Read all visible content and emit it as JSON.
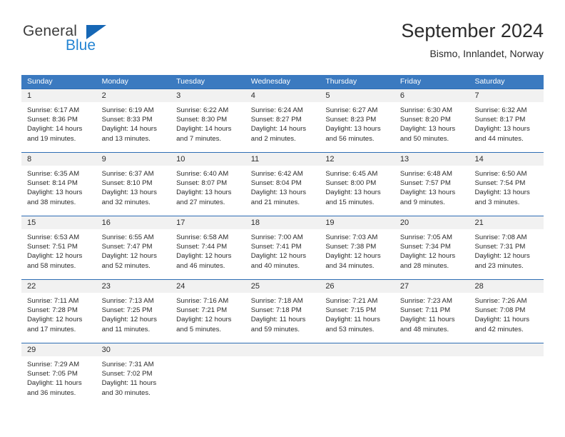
{
  "brand": {
    "name_top": "General",
    "name_bottom": "Blue",
    "triangle_color": "#1667b5",
    "blue_text_color": "#2585d3",
    "general_text_color": "#3c3c3c"
  },
  "header": {
    "title": "September 2024",
    "subtitle": "Bismo, Innlandet, Norway"
  },
  "theme": {
    "header_row_bg": "#3b7ac0",
    "week_divider": "#2e6db4",
    "day_band_bg": "#f1f1f1",
    "text": "#2b2b2b"
  },
  "weekdays": [
    "Sunday",
    "Monday",
    "Tuesday",
    "Wednesday",
    "Thursday",
    "Friday",
    "Saturday"
  ],
  "weeks": [
    [
      {
        "day": "1",
        "sunrise": "Sunrise: 6:17 AM",
        "sunset": "Sunset: 8:36 PM",
        "daylight_1": "Daylight: 14 hours",
        "daylight_2": "and 19 minutes."
      },
      {
        "day": "2",
        "sunrise": "Sunrise: 6:19 AM",
        "sunset": "Sunset: 8:33 PM",
        "daylight_1": "Daylight: 14 hours",
        "daylight_2": "and 13 minutes."
      },
      {
        "day": "3",
        "sunrise": "Sunrise: 6:22 AM",
        "sunset": "Sunset: 8:30 PM",
        "daylight_1": "Daylight: 14 hours",
        "daylight_2": "and 7 minutes."
      },
      {
        "day": "4",
        "sunrise": "Sunrise: 6:24 AM",
        "sunset": "Sunset: 8:27 PM",
        "daylight_1": "Daylight: 14 hours",
        "daylight_2": "and 2 minutes."
      },
      {
        "day": "5",
        "sunrise": "Sunrise: 6:27 AM",
        "sunset": "Sunset: 8:23 PM",
        "daylight_1": "Daylight: 13 hours",
        "daylight_2": "and 56 minutes."
      },
      {
        "day": "6",
        "sunrise": "Sunrise: 6:30 AM",
        "sunset": "Sunset: 8:20 PM",
        "daylight_1": "Daylight: 13 hours",
        "daylight_2": "and 50 minutes."
      },
      {
        "day": "7",
        "sunrise": "Sunrise: 6:32 AM",
        "sunset": "Sunset: 8:17 PM",
        "daylight_1": "Daylight: 13 hours",
        "daylight_2": "and 44 minutes."
      }
    ],
    [
      {
        "day": "8",
        "sunrise": "Sunrise: 6:35 AM",
        "sunset": "Sunset: 8:14 PM",
        "daylight_1": "Daylight: 13 hours",
        "daylight_2": "and 38 minutes."
      },
      {
        "day": "9",
        "sunrise": "Sunrise: 6:37 AM",
        "sunset": "Sunset: 8:10 PM",
        "daylight_1": "Daylight: 13 hours",
        "daylight_2": "and 32 minutes."
      },
      {
        "day": "10",
        "sunrise": "Sunrise: 6:40 AM",
        "sunset": "Sunset: 8:07 PM",
        "daylight_1": "Daylight: 13 hours",
        "daylight_2": "and 27 minutes."
      },
      {
        "day": "11",
        "sunrise": "Sunrise: 6:42 AM",
        "sunset": "Sunset: 8:04 PM",
        "daylight_1": "Daylight: 13 hours",
        "daylight_2": "and 21 minutes."
      },
      {
        "day": "12",
        "sunrise": "Sunrise: 6:45 AM",
        "sunset": "Sunset: 8:00 PM",
        "daylight_1": "Daylight: 13 hours",
        "daylight_2": "and 15 minutes."
      },
      {
        "day": "13",
        "sunrise": "Sunrise: 6:48 AM",
        "sunset": "Sunset: 7:57 PM",
        "daylight_1": "Daylight: 13 hours",
        "daylight_2": "and 9 minutes."
      },
      {
        "day": "14",
        "sunrise": "Sunrise: 6:50 AM",
        "sunset": "Sunset: 7:54 PM",
        "daylight_1": "Daylight: 13 hours",
        "daylight_2": "and 3 minutes."
      }
    ],
    [
      {
        "day": "15",
        "sunrise": "Sunrise: 6:53 AM",
        "sunset": "Sunset: 7:51 PM",
        "daylight_1": "Daylight: 12 hours",
        "daylight_2": "and 58 minutes."
      },
      {
        "day": "16",
        "sunrise": "Sunrise: 6:55 AM",
        "sunset": "Sunset: 7:47 PM",
        "daylight_1": "Daylight: 12 hours",
        "daylight_2": "and 52 minutes."
      },
      {
        "day": "17",
        "sunrise": "Sunrise: 6:58 AM",
        "sunset": "Sunset: 7:44 PM",
        "daylight_1": "Daylight: 12 hours",
        "daylight_2": "and 46 minutes."
      },
      {
        "day": "18",
        "sunrise": "Sunrise: 7:00 AM",
        "sunset": "Sunset: 7:41 PM",
        "daylight_1": "Daylight: 12 hours",
        "daylight_2": "and 40 minutes."
      },
      {
        "day": "19",
        "sunrise": "Sunrise: 7:03 AM",
        "sunset": "Sunset: 7:38 PM",
        "daylight_1": "Daylight: 12 hours",
        "daylight_2": "and 34 minutes."
      },
      {
        "day": "20",
        "sunrise": "Sunrise: 7:05 AM",
        "sunset": "Sunset: 7:34 PM",
        "daylight_1": "Daylight: 12 hours",
        "daylight_2": "and 28 minutes."
      },
      {
        "day": "21",
        "sunrise": "Sunrise: 7:08 AM",
        "sunset": "Sunset: 7:31 PM",
        "daylight_1": "Daylight: 12 hours",
        "daylight_2": "and 23 minutes."
      }
    ],
    [
      {
        "day": "22",
        "sunrise": "Sunrise: 7:11 AM",
        "sunset": "Sunset: 7:28 PM",
        "daylight_1": "Daylight: 12 hours",
        "daylight_2": "and 17 minutes."
      },
      {
        "day": "23",
        "sunrise": "Sunrise: 7:13 AM",
        "sunset": "Sunset: 7:25 PM",
        "daylight_1": "Daylight: 12 hours",
        "daylight_2": "and 11 minutes."
      },
      {
        "day": "24",
        "sunrise": "Sunrise: 7:16 AM",
        "sunset": "Sunset: 7:21 PM",
        "daylight_1": "Daylight: 12 hours",
        "daylight_2": "and 5 minutes."
      },
      {
        "day": "25",
        "sunrise": "Sunrise: 7:18 AM",
        "sunset": "Sunset: 7:18 PM",
        "daylight_1": "Daylight: 11 hours",
        "daylight_2": "and 59 minutes."
      },
      {
        "day": "26",
        "sunrise": "Sunrise: 7:21 AM",
        "sunset": "Sunset: 7:15 PM",
        "daylight_1": "Daylight: 11 hours",
        "daylight_2": "and 53 minutes."
      },
      {
        "day": "27",
        "sunrise": "Sunrise: 7:23 AM",
        "sunset": "Sunset: 7:11 PM",
        "daylight_1": "Daylight: 11 hours",
        "daylight_2": "and 48 minutes."
      },
      {
        "day": "28",
        "sunrise": "Sunrise: 7:26 AM",
        "sunset": "Sunset: 7:08 PM",
        "daylight_1": "Daylight: 11 hours",
        "daylight_2": "and 42 minutes."
      }
    ],
    [
      {
        "day": "29",
        "sunrise": "Sunrise: 7:29 AM",
        "sunset": "Sunset: 7:05 PM",
        "daylight_1": "Daylight: 11 hours",
        "daylight_2": "and 36 minutes."
      },
      {
        "day": "30",
        "sunrise": "Sunrise: 7:31 AM",
        "sunset": "Sunset: 7:02 PM",
        "daylight_1": "Daylight: 11 hours",
        "daylight_2": "and 30 minutes."
      },
      {
        "day": "",
        "sunrise": "",
        "sunset": "",
        "daylight_1": "",
        "daylight_2": ""
      },
      {
        "day": "",
        "sunrise": "",
        "sunset": "",
        "daylight_1": "",
        "daylight_2": ""
      },
      {
        "day": "",
        "sunrise": "",
        "sunset": "",
        "daylight_1": "",
        "daylight_2": ""
      },
      {
        "day": "",
        "sunrise": "",
        "sunset": "",
        "daylight_1": "",
        "daylight_2": ""
      },
      {
        "day": "",
        "sunrise": "",
        "sunset": "",
        "daylight_1": "",
        "daylight_2": ""
      }
    ]
  ]
}
